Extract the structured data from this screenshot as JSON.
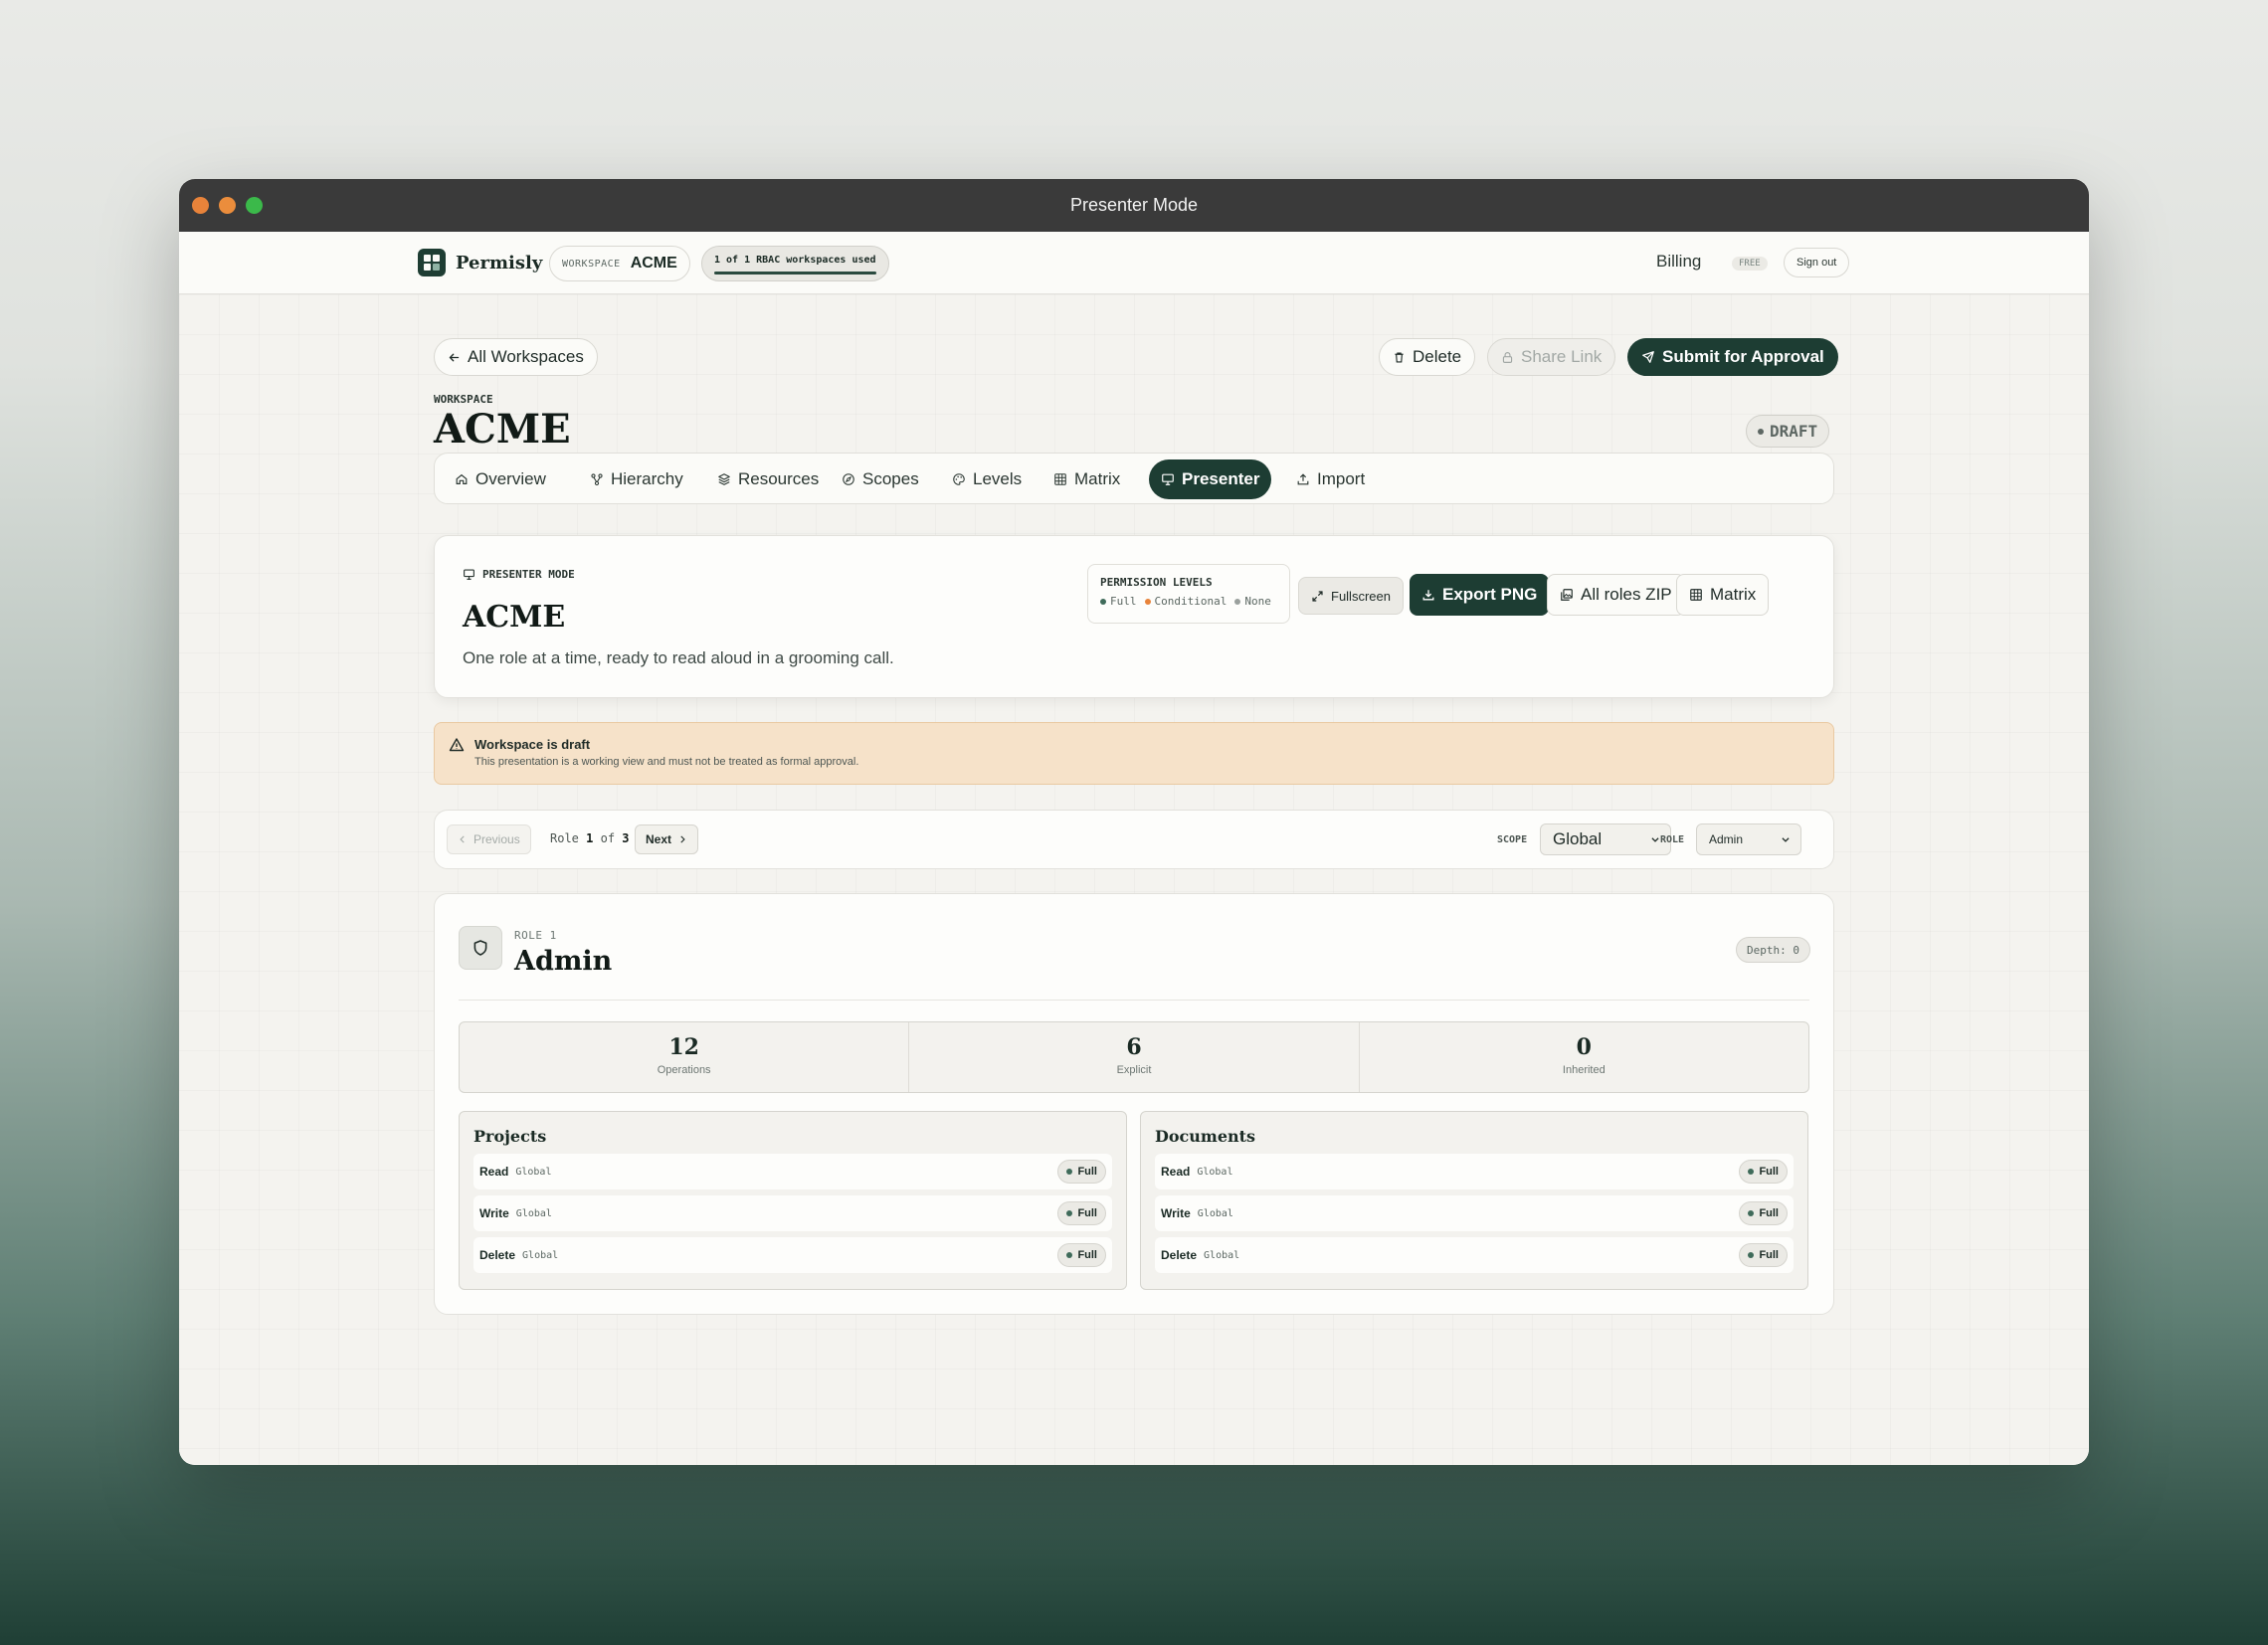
{
  "window": {
    "title": "Presenter Mode"
  },
  "appbar": {
    "brand": "Permisly",
    "workspace_label": "WORKSPACE",
    "workspace_name": "ACME",
    "usage": "1 of 1 RBAC workspaces used",
    "usage_fraction": 1.0,
    "billing": "Billing",
    "plan": "FREE",
    "sign_out": "Sign out"
  },
  "header": {
    "back": "All Workspaces",
    "delete": "Delete",
    "share": "Share Link",
    "submit": "Submit for Approval",
    "label": "WORKSPACE",
    "title": "ACME",
    "status": "DRAFT"
  },
  "tabs": [
    {
      "label": "Overview",
      "icon": "home-icon"
    },
    {
      "label": "Hierarchy",
      "icon": "hierarchy-icon"
    },
    {
      "label": "Resources",
      "icon": "layers-icon"
    },
    {
      "label": "Scopes",
      "icon": "compass-icon"
    },
    {
      "label": "Levels",
      "icon": "palette-icon"
    },
    {
      "label": "Matrix",
      "icon": "grid-icon"
    },
    {
      "label": "Presenter",
      "icon": "presentation-icon",
      "active": true
    },
    {
      "label": "Import",
      "icon": "upload-icon"
    }
  ],
  "presenter": {
    "label": "PRESENTER MODE",
    "title": "ACME",
    "subtitle": "One role at a time, ready to read aloud in a grooming call.",
    "levels_title": "PERMISSION LEVELS",
    "levels": [
      {
        "name": "Full",
        "color": "#3f6b5a"
      },
      {
        "name": "Conditional",
        "color": "#e8833a"
      },
      {
        "name": "None",
        "color": "#9aa09d"
      }
    ],
    "fullscreen": "Fullscreen",
    "export_png": "Export PNG",
    "all_roles_zip": "All roles ZIP",
    "matrix": "Matrix"
  },
  "alert": {
    "title": "Workspace is draft",
    "text": "This presentation is a working view and must not be treated as formal approval."
  },
  "navigator": {
    "previous": "Previous",
    "role_prefix": "Role",
    "current": "1",
    "of": "of",
    "total": "3",
    "next": "Next",
    "scope_label": "SCOPE",
    "scope_value": "Global",
    "role_label": "ROLE",
    "role_value": "Admin"
  },
  "role": {
    "number": "ROLE 1",
    "name": "Admin",
    "depth": "Depth: 0",
    "stats": [
      {
        "value": "12",
        "label": "Operations"
      },
      {
        "value": "6",
        "label": "Explicit"
      },
      {
        "value": "0",
        "label": "Inherited"
      }
    ],
    "resources": [
      {
        "name": "Projects",
        "ops": [
          {
            "name": "Read",
            "scope": "Global",
            "level": "Full"
          },
          {
            "name": "Write",
            "scope": "Global",
            "level": "Full"
          },
          {
            "name": "Delete",
            "scope": "Global",
            "level": "Full"
          }
        ]
      },
      {
        "name": "Documents",
        "ops": [
          {
            "name": "Read",
            "scope": "Global",
            "level": "Full"
          },
          {
            "name": "Write",
            "scope": "Global",
            "level": "Full"
          },
          {
            "name": "Delete",
            "scope": "Global",
            "level": "Full"
          }
        ]
      }
    ]
  },
  "colors": {
    "accent": "#1d3d33",
    "full": "#3f6b5a",
    "conditional": "#e8833a",
    "none": "#9aa09d",
    "alert_bg": "#f6e2c9"
  }
}
